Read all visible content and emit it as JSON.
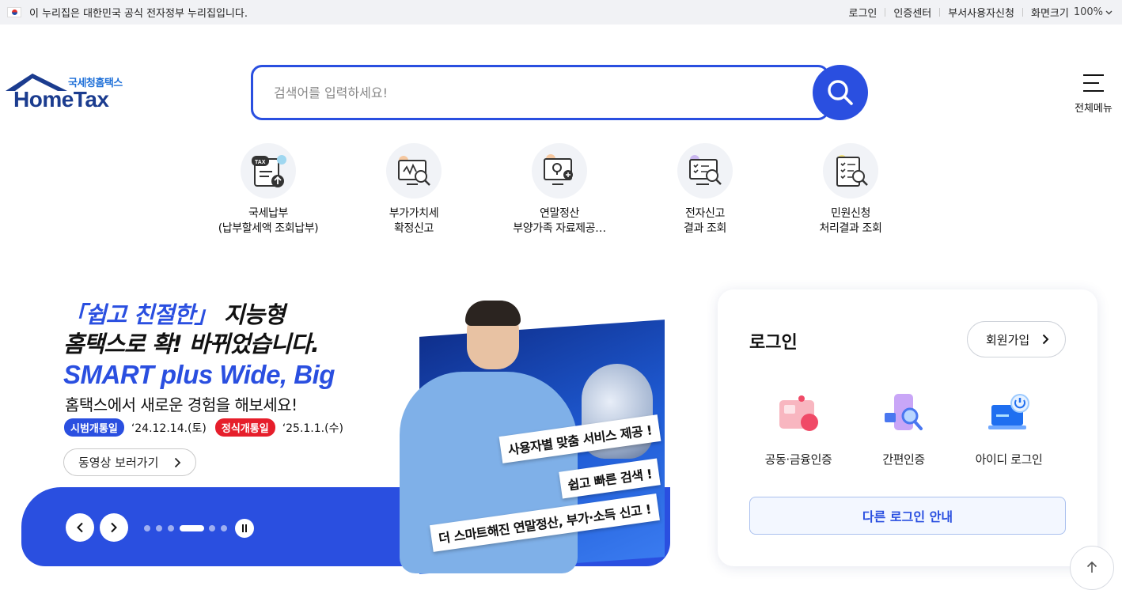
{
  "topbar": {
    "gov_notice": "이 누리집은 대한민국 공식 전자정부 누리집입니다.",
    "links": [
      "로그인",
      "인증센터",
      "부서사용자신청",
      "화면크기"
    ],
    "zoom_value": "100%"
  },
  "logo": {
    "subtitle": "국세청홈택스",
    "title": "HomeTax"
  },
  "search": {
    "placeholder": "검색어를 입력하세요!"
  },
  "all_menu": {
    "label": "전체메뉴"
  },
  "quick_menu": [
    {
      "line1": "국세납부",
      "line2": "(납부할세액 조회납부)",
      "icon": "tax-payment-icon"
    },
    {
      "line1": "부가가치세",
      "line2": "확정신고",
      "icon": "vat-report-icon"
    },
    {
      "line1": "연말정산",
      "line2": "부양가족 자료제공…",
      "icon": "year-end-settlement-icon"
    },
    {
      "line1": "전자신고",
      "line2": "결과 조회",
      "icon": "e-filing-result-icon"
    },
    {
      "line1": "민원신청",
      "line2": "처리결과 조회",
      "icon": "civil-petition-icon"
    }
  ],
  "hero": {
    "quote_open": "「쉽고 친절한」",
    "head1_rest": " 지능형",
    "head2": "홈택스로 확! 바뀌었습니다.",
    "big": "SMART plus Wide, Big",
    "sub": "홈택스에서 새로운 경험을 해보세요!",
    "badge1": "시범개통일",
    "date1": "‘24.12.14.(토)",
    "badge2": "정식개통일",
    "date2": "‘25.1.1.(수)",
    "video_button": "동영상 보러가기",
    "tag1": "사용자별 맞춤 서비스 제공 !",
    "tag2": "쉽고 빠른 검색 !",
    "tag3": "더 스마트해진 연말정산, 부가·소득 신고 !",
    "slide_count": 6,
    "active_slide": 4
  },
  "login": {
    "title": "로그인",
    "join_button": "회원가입",
    "options": [
      {
        "label": "공동·금융인증",
        "icon": "certificate-icon"
      },
      {
        "label": "간편인증",
        "icon": "simple-auth-icon"
      },
      {
        "label": "아이디 로그인",
        "icon": "id-login-icon"
      }
    ],
    "other_button": "다른 로그인 안내"
  },
  "colors": {
    "brand_blue": "#2a4fe0",
    "red_badge": "#e61e2b",
    "logo_navy": "#1b3c8f"
  }
}
